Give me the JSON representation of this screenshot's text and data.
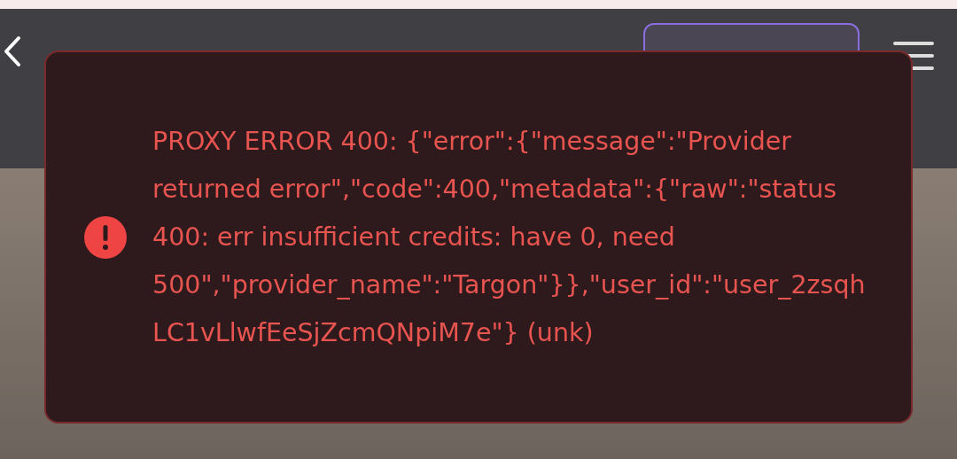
{
  "toast": {
    "kind": "error",
    "message": "PROXY ERROR 400: {\"error\":{\"message\":\"Provider returned error\",\"code\":400,\"metadata\":{\"raw\":\"status 400: err insufficient credits: have 0, need 500\",\"provider_name\":\"Targon\"}},\"user_id\":\"user_2zsqhLC1vLlwfEeSjZcmQNpiM7e\"} (unk)"
  }
}
